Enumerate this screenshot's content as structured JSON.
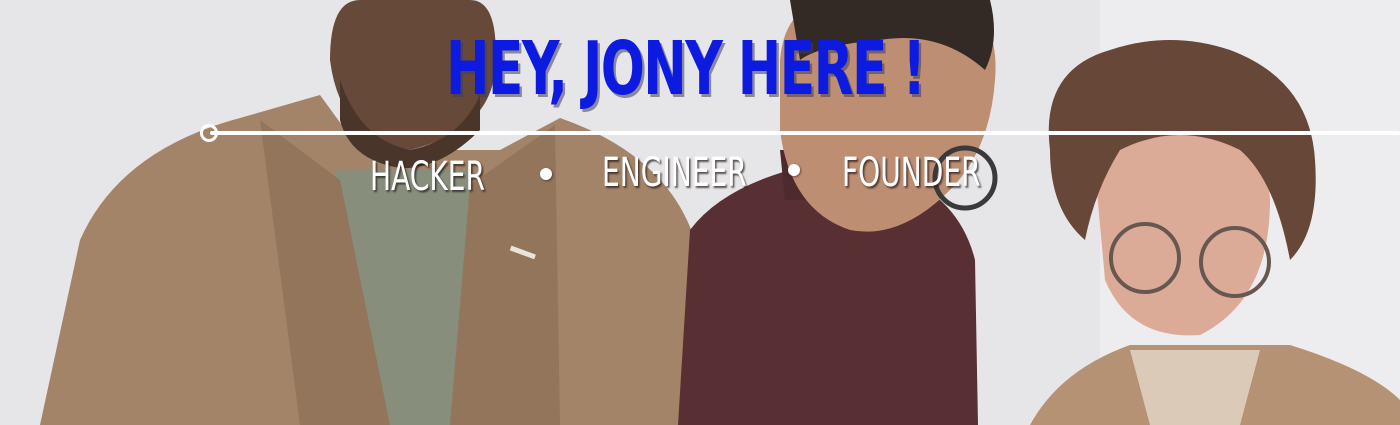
{
  "hero": {
    "headline": "HEY, JONY HERE !",
    "taglines": [
      {
        "label": "HACKER"
      },
      {
        "label": "ENGINEER"
      },
      {
        "label": "FOUNDER"
      }
    ],
    "separator": "•"
  },
  "colors": {
    "headline": "#0d1be0",
    "tagline": "#ffffff",
    "rule": "#ffffff"
  },
  "background": {
    "image": "team-photo-background"
  }
}
